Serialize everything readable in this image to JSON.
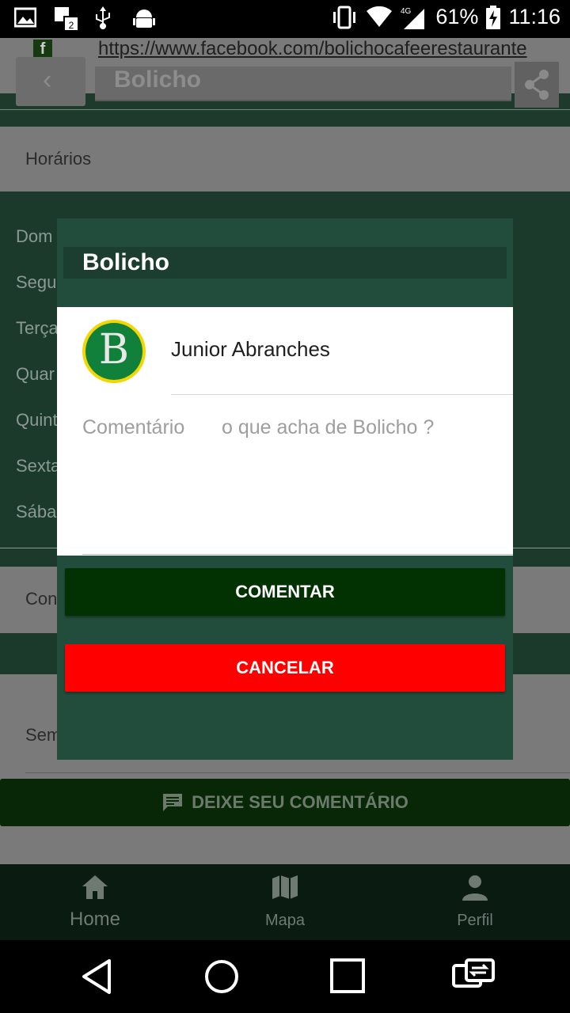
{
  "status_bar": {
    "battery": "61%",
    "time": "11:16",
    "network": "4G"
  },
  "background": {
    "facebook_url": "https://www.facebook.com/bolichocafeerestaurante",
    "toolbar_title": "Bolicho",
    "section_horarios": "Horários",
    "days": [
      "Dom",
      "Segu",
      "Terça",
      "Quar",
      "Quint",
      "Sexta",
      "Sába"
    ],
    "section_comentarios": "Con",
    "sem_text": "Sem",
    "deixe_button": "DEIXE SEU COMENTÁRIO"
  },
  "dialog": {
    "title": "Bolicho",
    "avatar_letter": "B",
    "user_name": "Junior Abranches",
    "comment_label": "Comentário",
    "comment_placeholder": "o que acha de Bolicho ?",
    "comment_value": "",
    "comentar_button": "COMENTAR",
    "cancelar_button": "CANCELAR"
  },
  "bottom_nav": {
    "items": [
      {
        "label": "Home",
        "icon": "home-icon"
      },
      {
        "label": "Mapa",
        "icon": "map-icon"
      },
      {
        "label": "Perfil",
        "icon": "person-icon"
      }
    ]
  },
  "colors": {
    "dialog_bg": "#224d3c",
    "comentar": "#023202",
    "cancelar": "#ff0000"
  }
}
